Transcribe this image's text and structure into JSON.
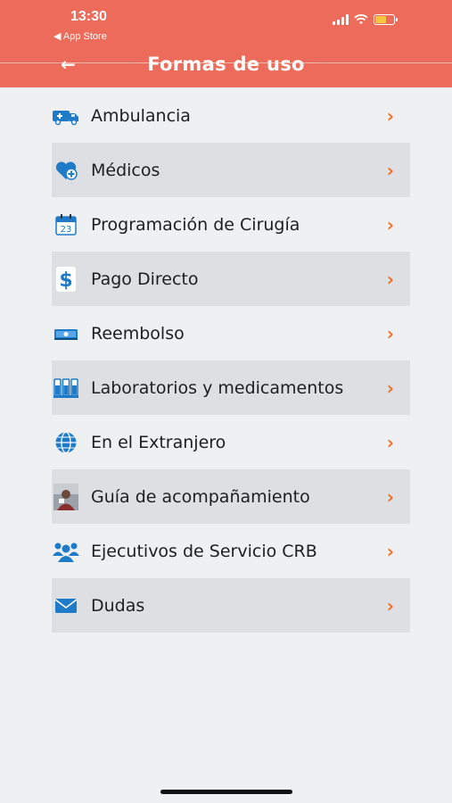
{
  "status_bar": {
    "time": "13:30",
    "back_app": "◀ App Store"
  },
  "header": {
    "title": "Formas de uso",
    "back_icon": "←"
  },
  "menu": [
    {
      "label": "Ambulancia",
      "icon": "ambulance-icon"
    },
    {
      "label": "Médicos",
      "icon": "doctor-heart-icon"
    },
    {
      "label": "Programación de Cirugía",
      "icon": "calendar-icon"
    },
    {
      "label": "Pago Directo",
      "icon": "dollar-icon"
    },
    {
      "label": "Reembolso",
      "icon": "money-bill-icon"
    },
    {
      "label": "Laboratorios y medicamentos",
      "icon": "lab-tubes-icon"
    },
    {
      "label": "En el Extranjero",
      "icon": "globe-icon"
    },
    {
      "label": "Guía de acompañamiento",
      "icon": "guide-photo-icon"
    },
    {
      "label": "Ejecutivos de Servicio CRB",
      "icon": "people-icon"
    },
    {
      "label": "Dudas",
      "icon": "mail-icon"
    }
  ],
  "colors": {
    "header": "#ec6b5a",
    "chevron": "#e8722a",
    "icon_blue": "#1f7bc8",
    "row_alt": "#dedfe2"
  }
}
